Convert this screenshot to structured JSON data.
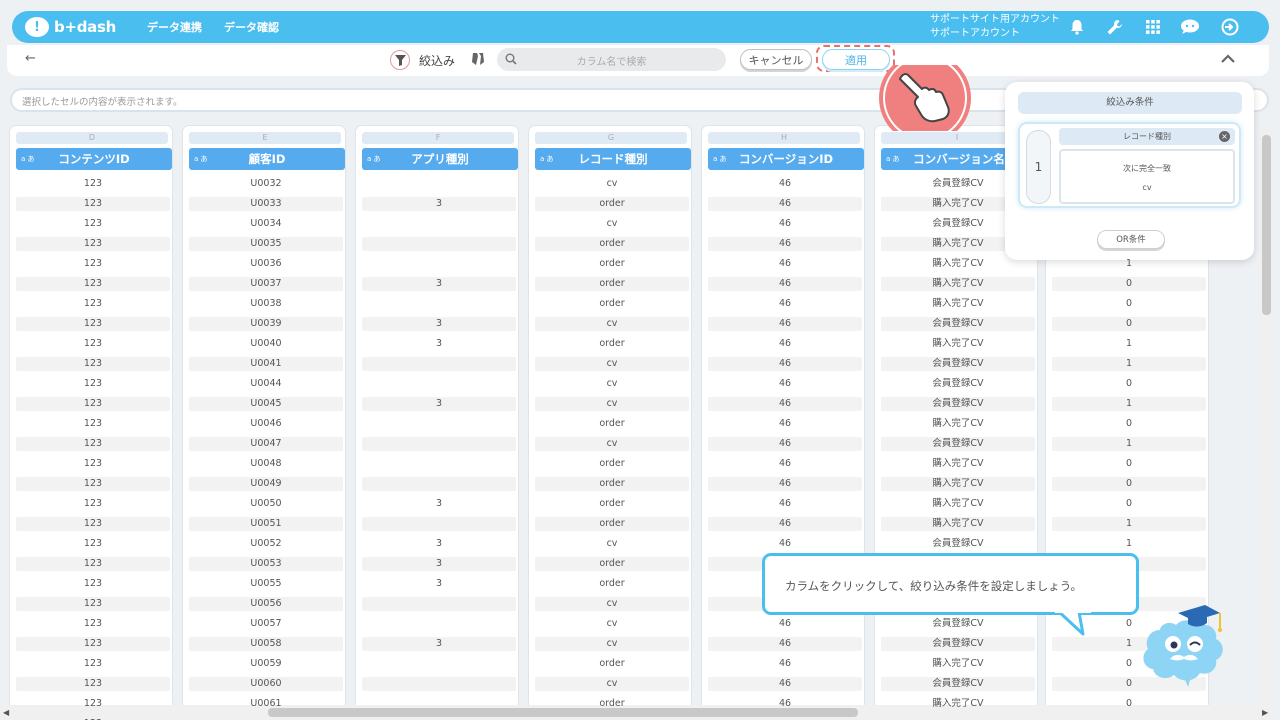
{
  "header": {
    "logo": "b+dash",
    "nav": [
      "データ連携",
      "データ確認"
    ],
    "account_line1": "サポートサイト用アカウント",
    "account_line2": "サポートアカウント",
    "icons": [
      "bell-icon",
      "wrench-icon",
      "grid-icon",
      "chat-icon",
      "logout-icon"
    ]
  },
  "toolbar": {
    "back": "←",
    "filter_label": "絞込み",
    "search_placeholder": "カラム名で検索",
    "cancel_label": "キャンセル",
    "apply_label": "適用",
    "collapse": "^"
  },
  "cell_bar": {
    "placeholder": "選択したセルの内容が表示されます。"
  },
  "type_badge": "a あ",
  "columns": [
    {
      "letter": "D",
      "name": "コンテンツID",
      "values": [
        "123",
        "123",
        "123",
        "123",
        "123",
        "123",
        "123",
        "123",
        "123",
        "123",
        "123",
        "123",
        "123",
        "123",
        "123",
        "123",
        "123",
        "123",
        "123",
        "123",
        "123",
        "123",
        "123",
        "123",
        "123",
        "123",
        "123",
        "123",
        "...123"
      ]
    },
    {
      "letter": "E",
      "name": "顧客ID",
      "values": [
        "U0032",
        "U0033",
        "U0034",
        "U0035",
        "U0036",
        "U0037",
        "U0038",
        "U0039",
        "U0040",
        "U0041",
        "U0044",
        "U0045",
        "U0046",
        "U0047",
        "U0048",
        "U0049",
        "U0050",
        "U0051",
        "U0052",
        "U0053",
        "U0055",
        "U0056",
        "U0057",
        "U0058",
        "U0059",
        "U0060",
        "U0061"
      ]
    },
    {
      "letter": "F",
      "name": "アプリ種別",
      "values": [
        "",
        "3",
        "",
        "",
        "",
        "3",
        "",
        "3",
        "3",
        "",
        "",
        "3",
        "",
        "",
        "",
        "",
        "3",
        "",
        "3",
        "3",
        "3",
        "",
        "",
        "3",
        "",
        "",
        ""
      ]
    },
    {
      "letter": "G",
      "name": "レコード種別",
      "values": [
        "cv",
        "order",
        "cv",
        "order",
        "order",
        "order",
        "order",
        "cv",
        "order",
        "cv",
        "cv",
        "cv",
        "order",
        "cv",
        "order",
        "order",
        "order",
        "order",
        "cv",
        "order",
        "order",
        "cv",
        "cv",
        "cv",
        "order",
        "cv",
        "order"
      ]
    },
    {
      "letter": "H",
      "name": "コンバージョンID",
      "values": [
        "46",
        "46",
        "46",
        "46",
        "46",
        "46",
        "46",
        "46",
        "46",
        "46",
        "46",
        "46",
        "46",
        "46",
        "46",
        "46",
        "46",
        "46",
        "46",
        "",
        "",
        "",
        "46",
        "46",
        "46",
        "46",
        "46"
      ]
    },
    {
      "letter": "I",
      "name": "コンバージョン名",
      "values": [
        "会員登録CV",
        "購入完了CV",
        "会員登録CV",
        "購入完了CV",
        "購入完了CV",
        "購入完了CV",
        "購入完了CV",
        "会員登録CV",
        "購入完了CV",
        "会員登録CV",
        "会員登録CV",
        "会員登録CV",
        "購入完了CV",
        "会員登録CV",
        "購入完了CV",
        "購入完了CV",
        "購入完了CV",
        "購入完了CV",
        "会員登録CV",
        "",
        "",
        "",
        "会員登録CV",
        "会員登録CV",
        "購入完了CV",
        "会員登録CV",
        "購入完了CV"
      ]
    },
    {
      "letter": "",
      "name": "",
      "values": [
        "",
        "",
        "",
        "",
        "1",
        "0",
        "0",
        "0",
        "1",
        "1",
        "0",
        "1",
        "0",
        "1",
        "0",
        "0",
        "0",
        "1",
        "1",
        "",
        "",
        "",
        "0",
        "1",
        "0",
        "0",
        "0"
      ]
    }
  ],
  "filter_popup": {
    "title": "絞込み条件",
    "condition_number": "1",
    "field": "レコード種別",
    "operator": "次に完全一致",
    "value": "cv",
    "or_button": "OR条件"
  },
  "tooltip": {
    "text": "カラムをクリックして、絞り込み条件を設定しましょう。"
  },
  "colors": {
    "brand": "#4bbef0",
    "header_col": "#56aaee",
    "highlight": "#e87070"
  }
}
